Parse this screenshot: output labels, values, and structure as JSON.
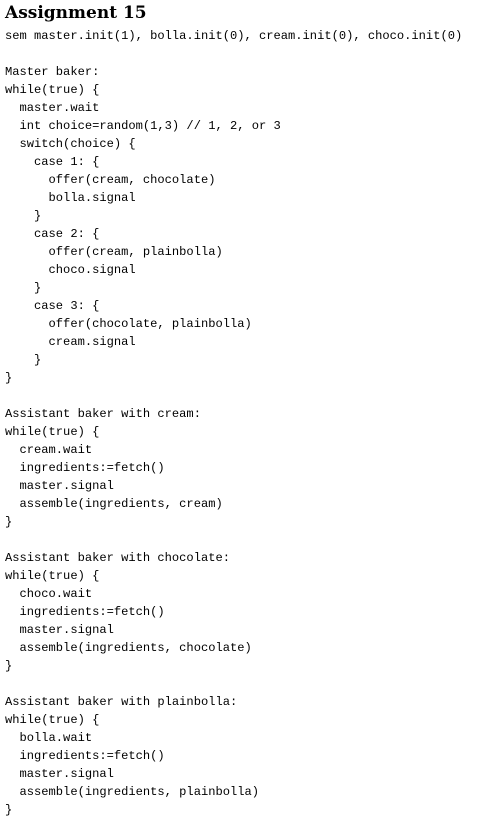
{
  "title": "Assignment 15",
  "code_lines": [
    "sem master.init(1), bolla.init(0), cream.init(0), choco.init(0)",
    "",
    "Master baker:",
    "while(true) {",
    "  master.wait",
    "  int choice=random(1,3) // 1, 2, or 3",
    "  switch(choice) {",
    "    case 1: {",
    "      offer(cream, chocolate)",
    "      bolla.signal",
    "    }",
    "    case 2: {",
    "      offer(cream, plainbolla)",
    "      choco.signal",
    "    }",
    "    case 3: {",
    "      offer(chocolate, plainbolla)",
    "      cream.signal",
    "    }",
    "}",
    "",
    "Assistant baker with cream:",
    "while(true) {",
    "  cream.wait",
    "  ingredients:=fetch()",
    "  master.signal",
    "  assemble(ingredients, cream)",
    "}",
    "",
    "Assistant baker with chocolate:",
    "while(true) {",
    "  choco.wait",
    "  ingredients:=fetch()",
    "  master.signal",
    "  assemble(ingredients, chocolate)",
    "}",
    "",
    "Assistant baker with plainbolla:",
    "while(true) {",
    "  bolla.wait",
    "  ingredients:=fetch()",
    "  master.signal",
    "  assemble(ingredients, plainbolla)",
    "}"
  ]
}
